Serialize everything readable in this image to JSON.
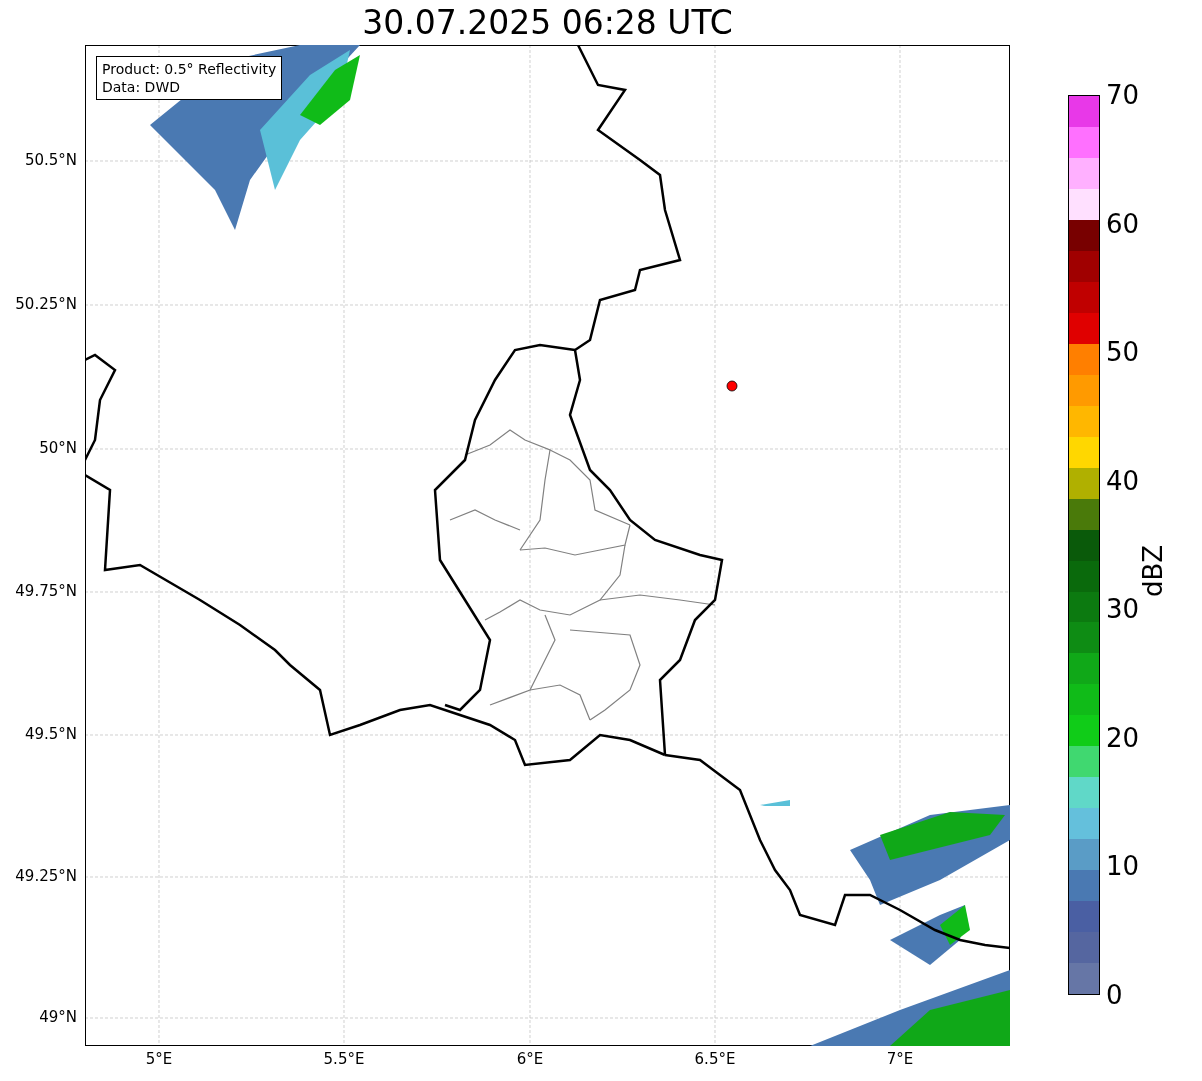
{
  "title": "30.07.2025 06:28 UTC",
  "map": {
    "info_box": [
      "Product: 0.5° Reflectivity",
      "Data: DWD"
    ],
    "lat_ticks": [
      "50.5°N",
      "50.25°N",
      "50°N",
      "49.75°N",
      "49.5°N",
      "49.25°N",
      "49°N"
    ],
    "lon_ticks": [
      "5°E",
      "5.5°E",
      "6°E",
      "6.5°E",
      "7°E"
    ]
  },
  "colorbar": {
    "label": "dBZ",
    "ticks": [
      "70",
      "60",
      "50",
      "40",
      "30",
      "20",
      "10",
      "0"
    ],
    "segments": [
      {
        "color": "#e838e8"
      },
      {
        "color": "#ff70ff"
      },
      {
        "color": "#ffb0ff"
      },
      {
        "color": "#ffe0ff"
      },
      {
        "color": "#780000"
      },
      {
        "color": "#a00000"
      },
      {
        "color": "#c00000"
      },
      {
        "color": "#e00000"
      },
      {
        "color": "#ff7f00"
      },
      {
        "color": "#ff9a00"
      },
      {
        "color": "#ffb700"
      },
      {
        "color": "#ffd700"
      },
      {
        "color": "#b0b000"
      },
      {
        "color": "#4a7a0a"
      },
      {
        "color": "#0a5a0a"
      },
      {
        "color": "#0a6a0c"
      },
      {
        "color": "#0c7a10"
      },
      {
        "color": "#0e8c14"
      },
      {
        "color": "#10a818"
      },
      {
        "color": "#10bb18"
      },
      {
        "color": "#10cc18"
      },
      {
        "color": "#40d870"
      },
      {
        "color": "#60d8c8"
      },
      {
        "color": "#64c0dc"
      },
      {
        "color": "#5a9cc6"
      },
      {
        "color": "#4a79b2"
      },
      {
        "color": "#4a5fa3"
      },
      {
        "color": "#5566a0"
      },
      {
        "color": "#6676a6"
      }
    ]
  }
}
